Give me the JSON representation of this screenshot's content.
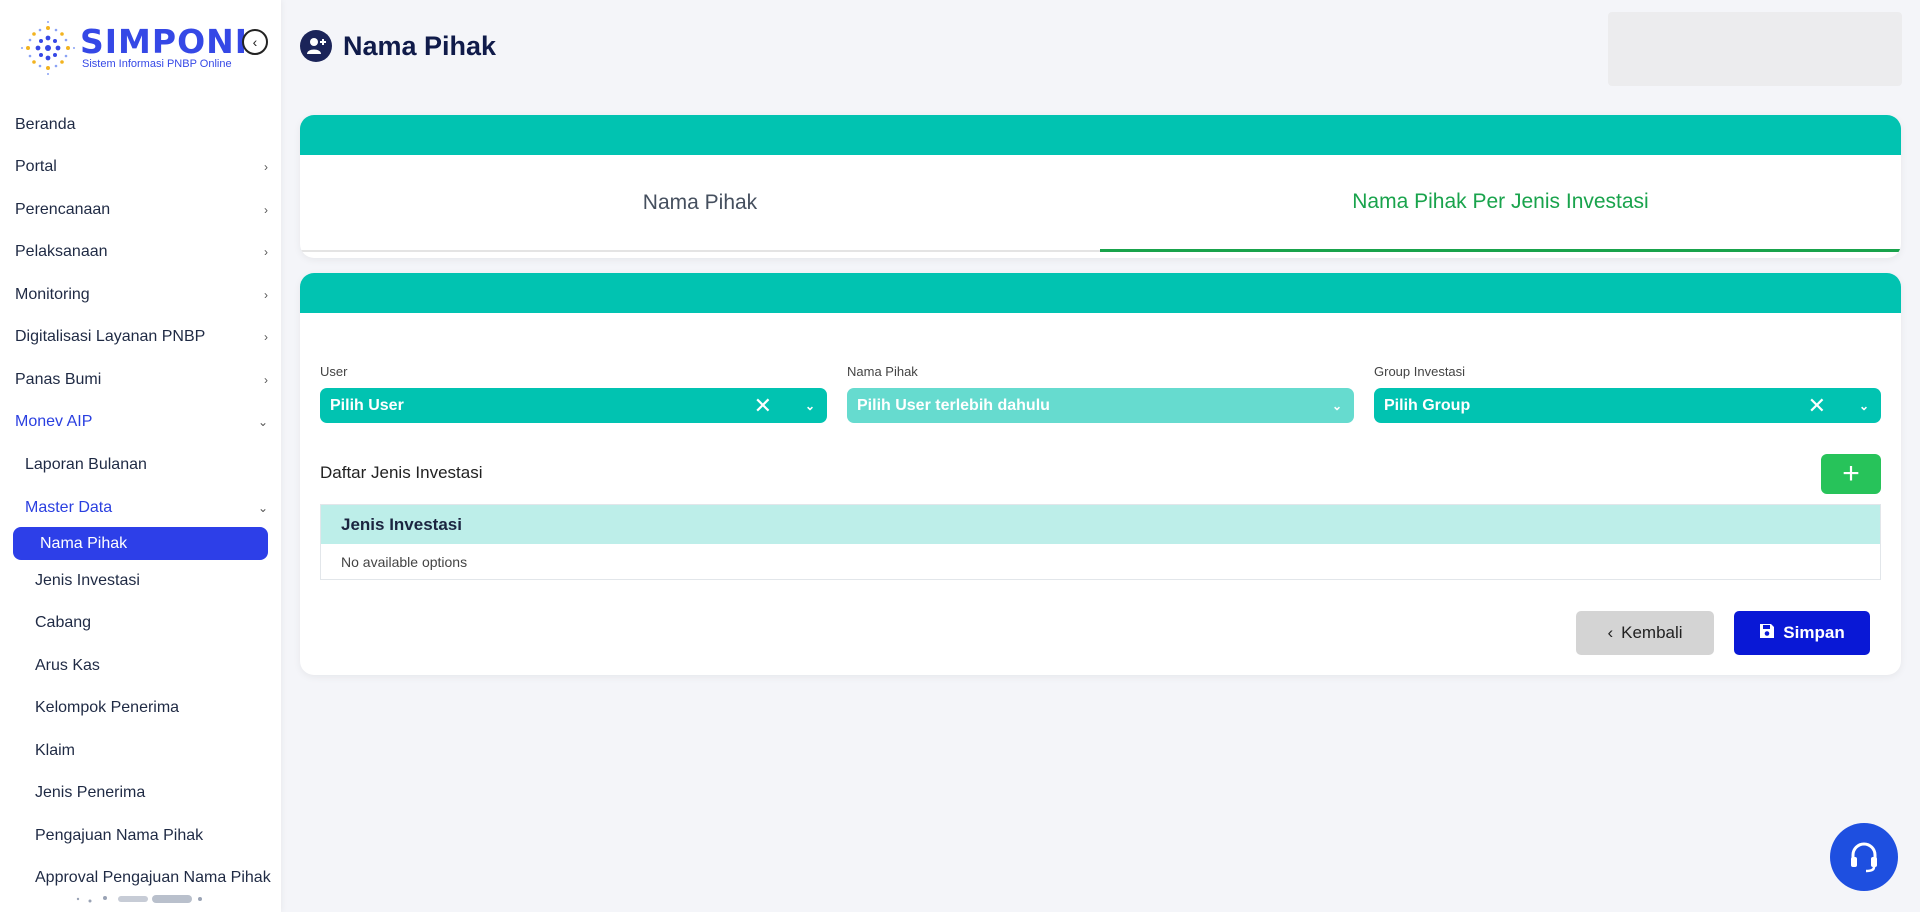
{
  "brand": {
    "title": "SIMPONI",
    "subtitle": "Sistem Informasi PNBP Online"
  },
  "sidebar": {
    "items": [
      {
        "label": "Beranda"
      },
      {
        "label": "Portal"
      },
      {
        "label": "Perencanaan"
      },
      {
        "label": "Pelaksanaan"
      },
      {
        "label": "Monitoring"
      },
      {
        "label": "Digitalisasi Layanan PNBP"
      },
      {
        "label": "Panas Bumi"
      },
      {
        "label": "Monev AIP"
      }
    ],
    "sub_items": [
      {
        "label": "Laporan Bulanan"
      },
      {
        "label": "Master Data"
      }
    ],
    "active_item": "Nama Pihak",
    "master_items": [
      {
        "label": "Jenis Investasi"
      },
      {
        "label": "Cabang"
      },
      {
        "label": "Arus Kas"
      },
      {
        "label": "Kelompok Penerima"
      },
      {
        "label": "Klaim"
      },
      {
        "label": "Jenis Penerima"
      },
      {
        "label": "Pengajuan Nama Pihak"
      },
      {
        "label": "Approval Pengajuan Nama Pihak"
      }
    ]
  },
  "header": {
    "title": "Nama Pihak"
  },
  "tabs": [
    {
      "label": "Nama Pihak",
      "active": false
    },
    {
      "label": "Nama Pihak Per Jenis Investasi",
      "active": true
    }
  ],
  "form": {
    "user": {
      "label": "User",
      "value": "Pilih User"
    },
    "nama_pihak": {
      "label": "Nama Pihak",
      "value": "Pilih User terlebih dahulu"
    },
    "group_investasi": {
      "label": "Group Investasi",
      "value": "Pilih Group"
    },
    "daftar_label": "Daftar Jenis Investasi",
    "add_label": "+"
  },
  "table": {
    "header": "Jenis Investasi",
    "empty_text": "No available options"
  },
  "buttons": {
    "back_label": "Kembali",
    "save_label": "Simpan"
  },
  "colors": {
    "primary": "#2d3fe8",
    "teal": "#01c3b1",
    "teal_disabled": "#66dbcf",
    "green": "#19a34c",
    "save": "#0918d6"
  }
}
